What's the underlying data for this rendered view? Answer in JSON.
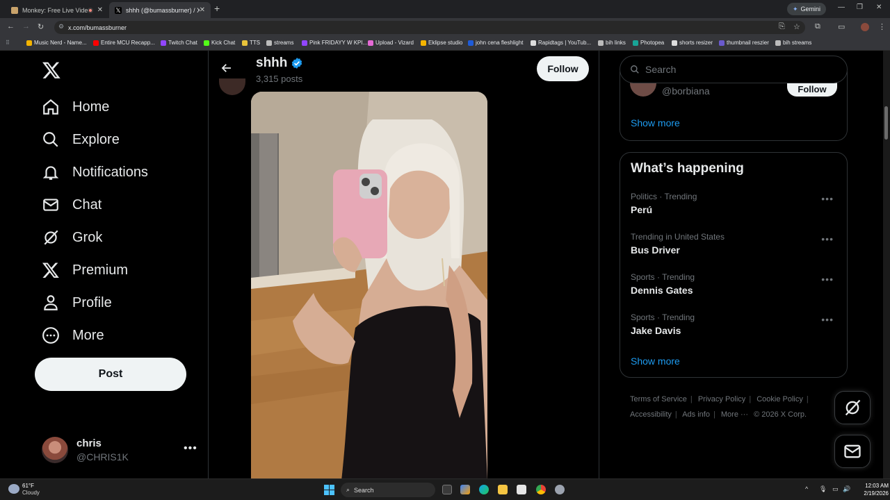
{
  "browser": {
    "tabs": [
      {
        "title": "Monkey: Free Live Video Ch"
      },
      {
        "title": "shhh (@bumassburner) / X"
      }
    ],
    "new_tab_symbol": "+",
    "gemini_label": "Gemini",
    "url": "x.com/bumassburner",
    "bookmarks": [
      "Music Nerd - Name...",
      "Entire MCU Recapp...",
      "Twitch Chat",
      "Kick Chat",
      "TTS",
      "streams",
      "Pink FRIDAYY W KPI...",
      "Upload - Vizard",
      "Eklipse studio",
      "john cena fleshlight",
      "Rapidtags | YouTub...",
      "bih links",
      "Photopea",
      "shorts resizer",
      "thumbnail reszier",
      "bih streams"
    ]
  },
  "nav": {
    "items": [
      {
        "label": "Home",
        "icon": "home-icon"
      },
      {
        "label": "Explore",
        "icon": "search-icon"
      },
      {
        "label": "Notifications",
        "icon": "bell-icon"
      },
      {
        "label": "Chat",
        "icon": "mail-icon"
      },
      {
        "label": "Grok",
        "icon": "grok-icon"
      },
      {
        "label": "Premium",
        "icon": "x-logo-icon"
      },
      {
        "label": "Profile",
        "icon": "person-icon"
      },
      {
        "label": "More",
        "icon": "more-circle-icon"
      }
    ],
    "post_label": "Post",
    "user": {
      "name": "chris",
      "handle": "@CHRIS1K"
    }
  },
  "profile_header": {
    "name": "shhh",
    "posts_count": "3,315 posts",
    "follow_label": "Follow"
  },
  "sidebar": {
    "search_placeholder": "Search",
    "suggestion": {
      "handle": "@borbiana",
      "follow_label": "Follow"
    },
    "show_more": "Show more",
    "whats_happening": "What’s happening",
    "trends": [
      {
        "context": "Politics · Trending",
        "topic": "Perú"
      },
      {
        "context": "Trending in United States",
        "topic": "Bus Driver"
      },
      {
        "context": "Sports · Trending",
        "topic": "Dennis Gates"
      },
      {
        "context": "Sports · Trending",
        "topic": "Jake Davis"
      }
    ],
    "show_more_2": "Show more",
    "footer": {
      "terms": "Terms of Service",
      "privacy": "Privacy Policy",
      "cookie": "Cookie Policy",
      "accessibility": "Accessibility",
      "ads": "Ads info",
      "more": "More ···",
      "copyright": "© 2026 X Corp."
    }
  },
  "taskbar": {
    "weather_temp": "61°F",
    "weather_cond": "Cloudy",
    "search_label": "Search",
    "time": "12:03 AM",
    "date": "2/19/2026"
  }
}
